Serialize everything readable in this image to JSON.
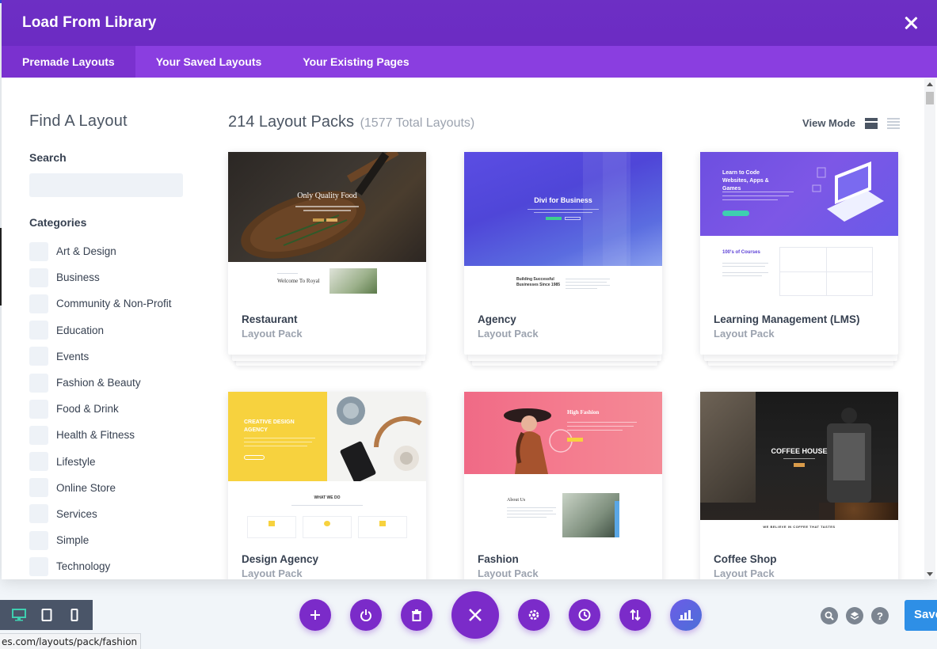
{
  "modal": {
    "title": "Load From Library"
  },
  "tabs": [
    {
      "label": "Premade Layouts",
      "active": true
    },
    {
      "label": "Your Saved Layouts",
      "active": false
    },
    {
      "label": "Your Existing Pages",
      "active": false
    }
  ],
  "sidebar": {
    "title": "Find A Layout",
    "search_label": "Search",
    "search_value": "",
    "categories_label": "Categories",
    "categories": [
      "Art & Design",
      "Business",
      "Community & Non-Profit",
      "Education",
      "Events",
      "Fashion & Beauty",
      "Food & Drink",
      "Health & Fitness",
      "Lifestyle",
      "Online Store",
      "Services",
      "Simple",
      "Technology"
    ]
  },
  "main": {
    "packs_count": "214 Layout Packs",
    "total_layouts": "(1577 Total Layouts)",
    "view_mode_label": "View Mode"
  },
  "cards": [
    {
      "name": "Restaurant",
      "sub": "Layout Pack",
      "thumb_title": "Only Quality Food",
      "thumb_sub": "Welcome To Royal"
    },
    {
      "name": "Agency",
      "sub": "Layout Pack",
      "thumb_title": "Divi for Business",
      "thumb_sub": "Building Successful Businesses Since 1985"
    },
    {
      "name": "Learning Management (LMS)",
      "sub": "Layout Pack",
      "thumb_title": "Learn to Code Websites, Apps & Games",
      "thumb_sub": "100's of Courses"
    },
    {
      "name": "Design Agency",
      "sub": "Layout Pack",
      "thumb_title": "CREATIVE DESIGN AGENCY",
      "thumb_sub": "WHAT WE DO"
    },
    {
      "name": "Fashion",
      "sub": "Layout Pack",
      "thumb_title": "High Fashion",
      "thumb_sub": "About Us"
    },
    {
      "name": "Coffee Shop",
      "sub": "Layout Pack",
      "thumb_title": "COFFEE HOUSE",
      "thumb_sub": "WE BELIEVE IN COFFEE THAT TASTES"
    }
  ],
  "toolbar": {
    "save_label": "Save",
    "help_label": "?"
  },
  "status_url": "es.com/layouts/pack/fashion",
  "colors": {
    "primary": "#7b2bc9",
    "tabbar": "#8a3ee0",
    "save": "#2e8fe6"
  }
}
